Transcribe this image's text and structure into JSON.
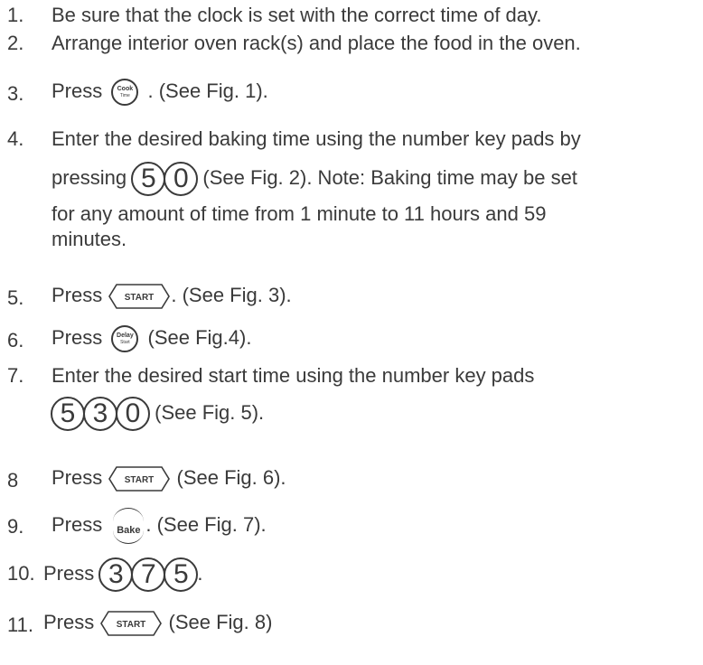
{
  "steps": [
    {
      "num": "1.",
      "text": "Be sure that the clock is set with the correct time of day."
    },
    {
      "num": "2.",
      "text": "Arrange interior oven rack(s) and place the food in the oven."
    },
    {
      "num": "3.",
      "before": "Press",
      "key_line1": "Cook",
      "key_line2": "Time",
      "after": ". (See Fig. 1)."
    },
    {
      "num": "4.",
      "line1": "Enter the desired baking time using the number key pads by",
      "before": "pressing",
      "digits": [
        "5",
        "0"
      ],
      "after": "(See Fig. 2). Note: Baking time may be set",
      "line3": "for any amount of time from 1 minute to 11 hours and 59",
      "line4": "minutes."
    },
    {
      "num": "5.",
      "before": "Press",
      "key": "START",
      "after": ". (See Fig. 3)."
    },
    {
      "num": "6.",
      "before": "Press",
      "key_line1": "Delay",
      "key_line2": "Start",
      "after": "(See Fig.4)."
    },
    {
      "num": "7.",
      "line1": "Enter the desired start time using the number key pads",
      "digits": [
        "5",
        "3",
        "0"
      ],
      "after": "(See Fig. 5)."
    },
    {
      "num": "8",
      "before": "Press",
      "key": "START",
      "after": "(See Fig. 6)."
    },
    {
      "num": "9.",
      "before": "Press",
      "key": "Bake",
      "after": ". (See Fig. 7)."
    },
    {
      "num": "10.",
      "before": "Press",
      "digits": [
        "3",
        "7",
        "5"
      ],
      "after": "."
    },
    {
      "num": "11.",
      "before": "Press",
      "key": "START",
      "after": "(See Fig. 8)"
    }
  ]
}
